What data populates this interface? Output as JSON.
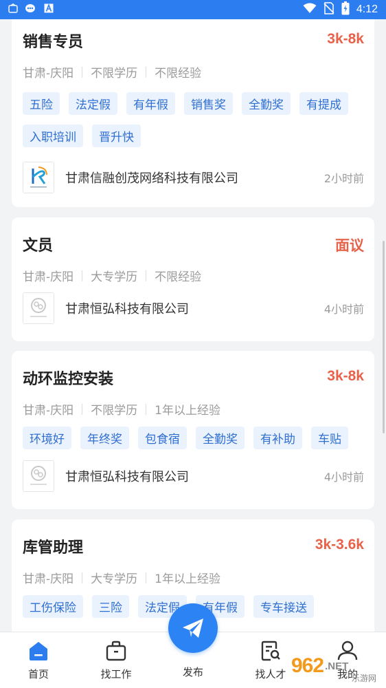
{
  "status_bar": {
    "time": "4:12"
  },
  "jobs": [
    {
      "title": "销售专员",
      "salary": "3k-8k",
      "location": "甘肃-庆阳",
      "education": "不限学历",
      "experience": "不限经验",
      "tags": [
        "五险",
        "法定假",
        "有年假",
        "销售奖",
        "全勤奖",
        "有提成",
        "入职培训",
        "晋升快"
      ],
      "company": "甘肃信融创茂网络科技有限公司",
      "time": "2小时前"
    },
    {
      "title": "文员",
      "salary": "面议",
      "location": "甘肃-庆阳",
      "education": "大专学历",
      "experience": "不限经验",
      "tags": [],
      "company": "甘肃恒弘科技有限公司",
      "time": "4小时前"
    },
    {
      "title": "动环监控安装",
      "salary": "3k-8k",
      "location": "甘肃-庆阳",
      "education": "不限学历",
      "experience": "1年以上经验",
      "tags": [
        "环境好",
        "年终奖",
        "包食宿",
        "全勤奖",
        "有补助",
        "车贴"
      ],
      "company": "甘肃恒弘科技有限公司",
      "time": "4小时前"
    },
    {
      "title": "库管助理",
      "salary": "3k-3.6k",
      "location": "甘肃-庆阳",
      "education": "大专学历",
      "experience": "1年以上经验",
      "tags": [
        "工伤保险",
        "三险",
        "法定假",
        "有年假",
        "专车接送"
      ],
      "company": "",
      "time": ""
    }
  ],
  "tabbar": {
    "home": "首页",
    "find_job": "找工作",
    "publish": "发布",
    "find_talent": "找人才",
    "mine": "我的"
  },
  "watermark": {
    "main": "962",
    "net": ".NET",
    "sub": "乐游网"
  },
  "colors": {
    "accent": "#2c7df0",
    "salary": "#e8624a",
    "tag_bg": "#eaf2fe",
    "tag_text": "#2f6fd0"
  }
}
